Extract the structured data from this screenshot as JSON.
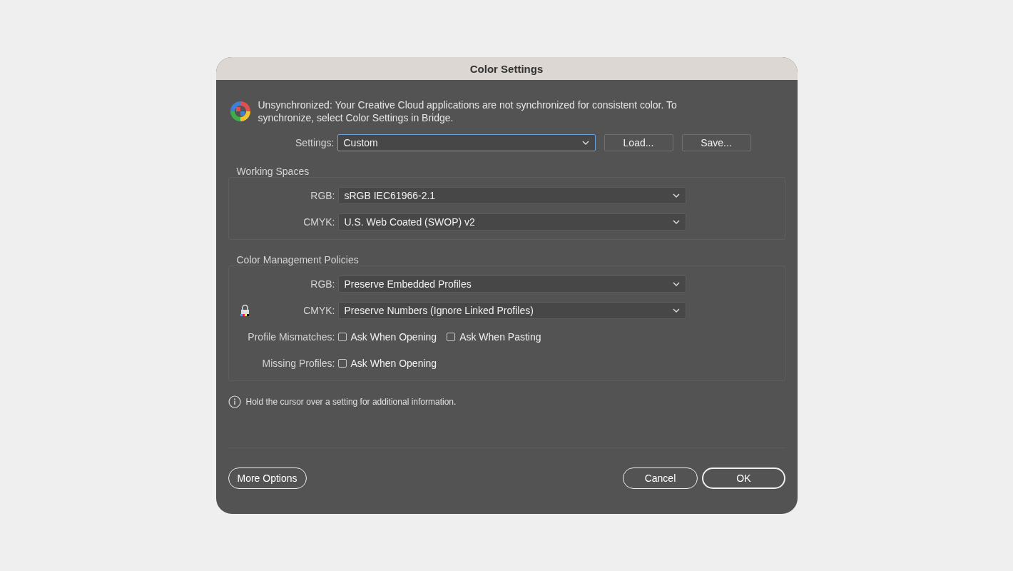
{
  "window": {
    "title": "Color Settings"
  },
  "message": "Unsynchronized: Your Creative Cloud applications are not synchronized for consistent color. To synchronize, select Color Settings in Bridge.",
  "settings": {
    "label": "Settings:",
    "value": "Custom",
    "focused": true,
    "buttons": [
      "Load...",
      "Save..."
    ]
  },
  "groups": [
    {
      "title": "Working Spaces",
      "rows": [
        {
          "kind": "select",
          "label": "RGB:",
          "value": "sRGB IEC61966-2.1"
        },
        {
          "kind": "select",
          "label": "CMYK:",
          "value": "U.S. Web Coated (SWOP) v2"
        }
      ]
    },
    {
      "title": "Color Management Policies",
      "rows": [
        {
          "kind": "select",
          "label": "RGB:",
          "value": "Preserve Embedded Profiles"
        },
        {
          "kind": "select",
          "label": "CMYK:",
          "value": "Preserve Numbers (Ignore Linked Profiles)",
          "locked": true
        },
        {
          "kind": "checks",
          "label": "Profile Mismatches:",
          "options": [
            {
              "label": "Ask When Opening",
              "checked": false
            },
            {
              "label": "Ask When Pasting",
              "checked": false
            }
          ]
        },
        {
          "kind": "checks",
          "label": "Missing Profiles:",
          "options": [
            {
              "label": "Ask When Opening",
              "checked": false
            }
          ]
        }
      ]
    }
  ],
  "hint": "Hold the cursor over a setting for additional information.",
  "footer": {
    "left": [
      {
        "label": "More Options",
        "default": false
      }
    ],
    "right": [
      {
        "label": "Cancel",
        "default": false
      },
      {
        "label": "OK",
        "default": true
      }
    ]
  }
}
